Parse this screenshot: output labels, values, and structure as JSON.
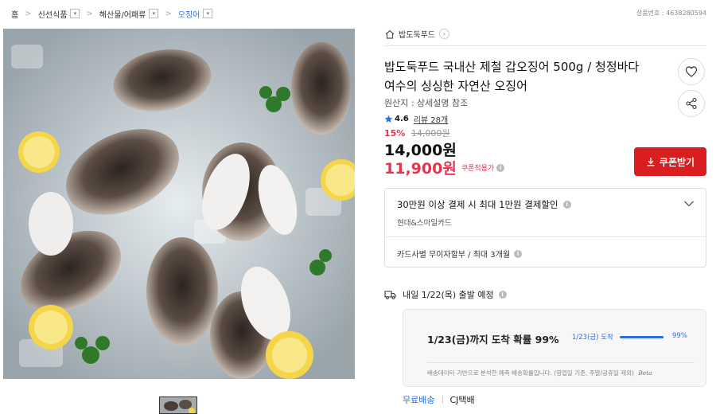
{
  "breadcrumb": {
    "items": [
      "홈",
      "신선식품",
      "해산물/어패류",
      "오징어"
    ]
  },
  "product_number": "상품번호 : 4638280594",
  "store": {
    "name": "밥도둑푸드"
  },
  "product": {
    "title_line1": "밥도둑푸드 국내산 제철 갑오징어 500g / 청정바다",
    "title_line2": "여수의 싱싱한 자연산 오징어",
    "origin": "원산지 : 상세설명 참조",
    "rating": "4.6",
    "reviews": "리뷰 28개",
    "discount_rate": "15%",
    "original_price": "14,000원",
    "price": "14,000원",
    "coupon_price": "11,900원",
    "coupon_note": "쿠폰적용가"
  },
  "buttons": {
    "coupon": "쿠폰받기"
  },
  "payment": {
    "promo": "30만원 이상 결제 시 최대 1만원 결제할인",
    "card": "현대&스마일카드",
    "installment": "카드사별 무이자할부 / 최대 3개월"
  },
  "shipping": {
    "departure": "내일 1/22(목) 출발 예정",
    "arrival_main": "1/23(금)까지 도착 확률 99%",
    "arrival_label": "1/23(금) 도착",
    "arrival_pct": "99%",
    "arrival_fraction": 0.99,
    "note": "배송데이터 기반으로 분석한 예측 배송확률입니다. (영업일 기준, 주말/공휴일 제외)",
    "beta": "Beta",
    "free": "무료배송",
    "courier": "CJ택배"
  },
  "colors": {
    "accent_red": "#d81e1e",
    "sale_red": "#e8344e",
    "link_blue": "#2f6fdb"
  },
  "icons": [
    "home-icon",
    "heart-icon",
    "share-icon",
    "star-icon",
    "truck-icon",
    "download-icon",
    "info-icon",
    "chevron-down-icon"
  ]
}
